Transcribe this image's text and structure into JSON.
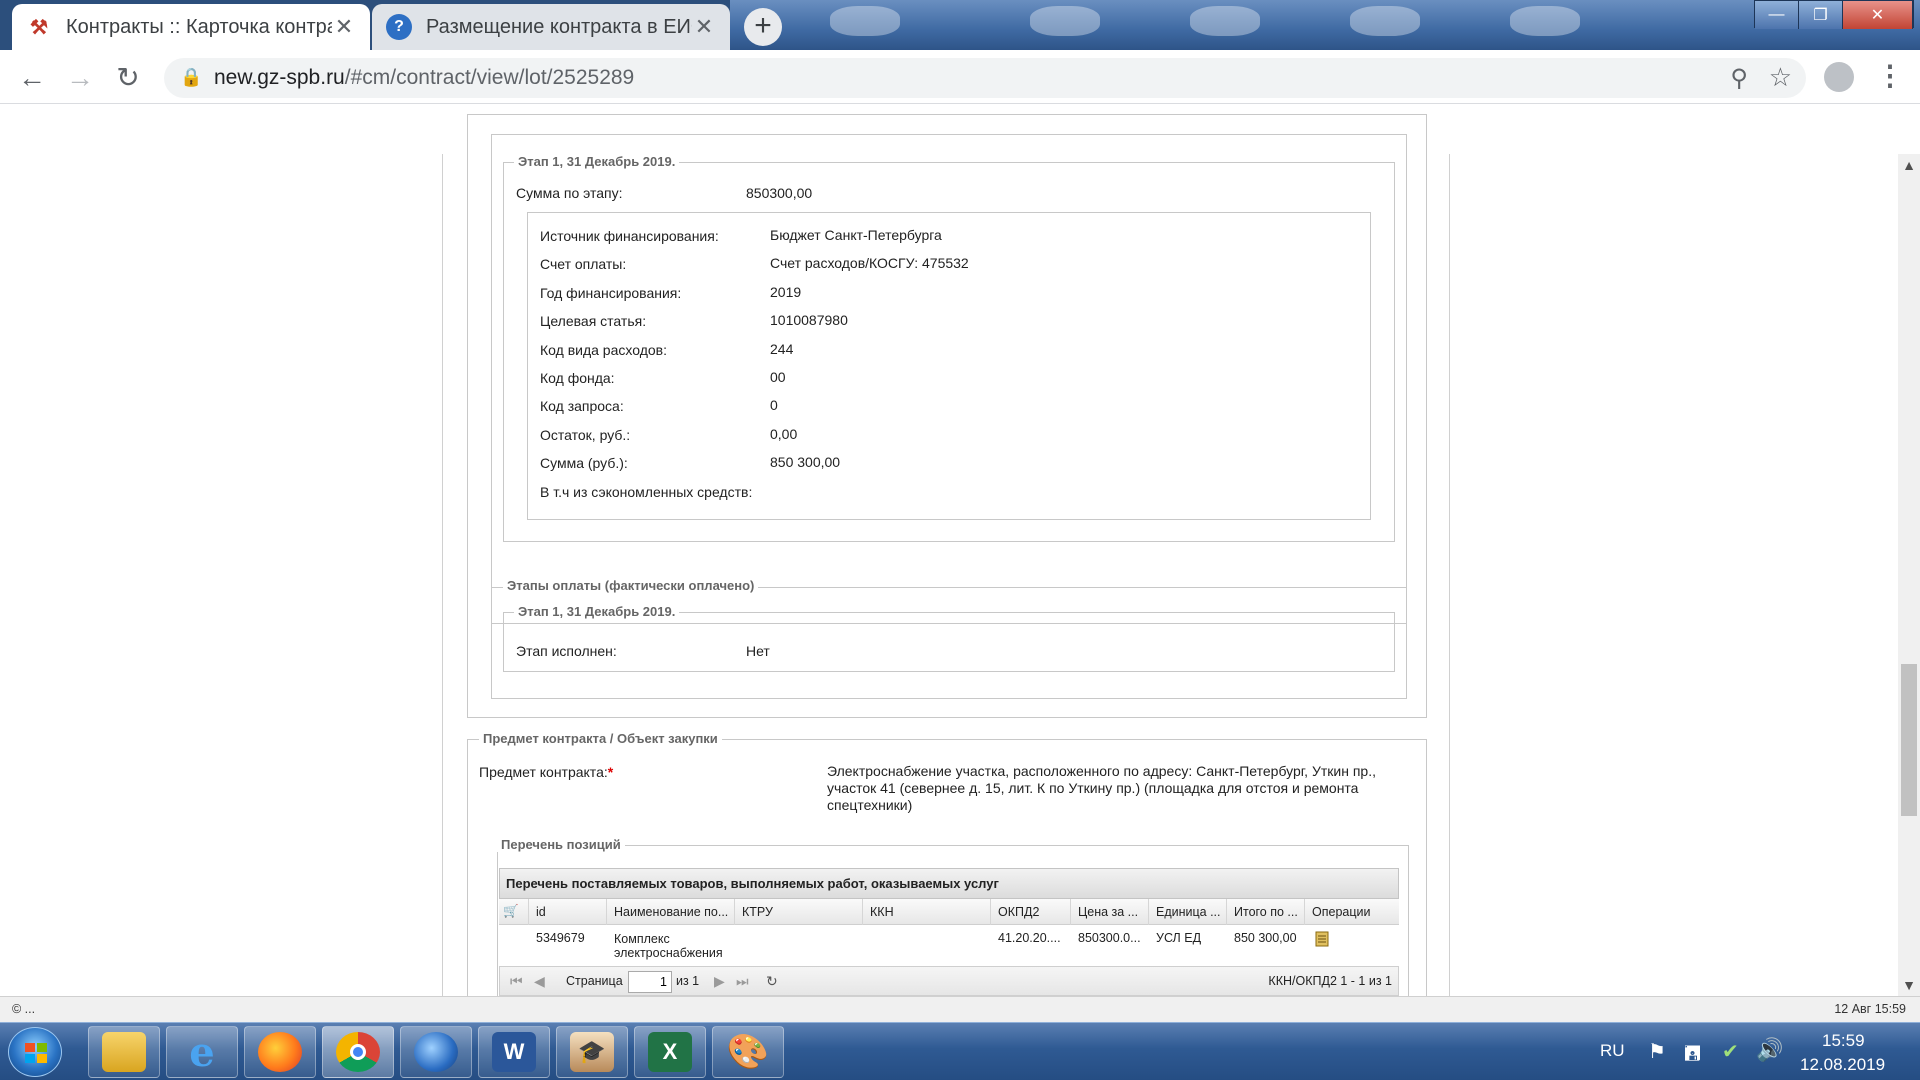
{
  "browser": {
    "tabs": [
      {
        "title": "Контракты :: Карточка контракт",
        "active": true
      },
      {
        "title": "Размещение контракта в ЕИС |",
        "active": false
      }
    ],
    "url_host": "new.gz-spb.ru",
    "url_path": "/#cm/contract/view/lot/2525289"
  },
  "stage_plan": {
    "legend": "Этап 1, 31 Декабрь 2019.",
    "sum_label": "Сумма по этапу:",
    "sum_value": "850300,00",
    "financing": [
      {
        "label": "Источник финансирования:",
        "value": "Бюджет Санкт-Петербурга"
      },
      {
        "label": "Счет оплаты:",
        "value": "Счет расходов/КОСГУ: 475532"
      },
      {
        "label": "Год финансирования:",
        "value": "2019"
      },
      {
        "label": "Целевая статья:",
        "value": "1010087980"
      },
      {
        "label": "Код вида расходов:",
        "value": "244"
      },
      {
        "label": "Код фонда:",
        "value": "00"
      },
      {
        "label": "Код запроса:",
        "value": "0"
      },
      {
        "label": "Остаток, руб.:",
        "value": "0,00"
      },
      {
        "label": "Сумма (руб.):",
        "value": "850 300,00"
      },
      {
        "label": "В т.ч из сэкономленных средств:",
        "value": ""
      }
    ]
  },
  "stage_paid": {
    "legend": "Этапы оплаты (фактически оплачено)",
    "inner_legend": "Этап 1, 31 Декабрь 2019.",
    "done_label": "Этап исполнен:",
    "done_value": "Нет"
  },
  "subject": {
    "legend": "Предмет контракта / Объект закупки",
    "label": "Предмет контракта:",
    "required_mark": "*",
    "text_lines": [
      "Электроснабжение  участка, расположенного по адресу: Санкт-Петербург, Уткин пр.,",
      "участок 41 (севернее д. 15, лит. К по Уткину пр.) (площадка для отстоя и ремонта",
      "спецтехники)"
    ]
  },
  "positions": {
    "legend": "Перечень позиций",
    "grid_title": "Перечень поставляемых товаров, выполняемых работ, оказываемых услуг",
    "columns": [
      "id",
      "Наименование по...",
      "КТРУ",
      "ККН",
      "ОКПД2",
      "Цена за ...",
      "Единица ...",
      "Итого по ...",
      "Операции"
    ],
    "row": {
      "id": "5349679",
      "name_line1": "Комплекс",
      "name_line2": "электроснабжения",
      "ktru": "",
      "kkn": "",
      "okpd2": "41.20.20....",
      "price": "850300.0...",
      "unit": "УСЛ ЕД",
      "total": "850 300,00"
    },
    "pager": {
      "page_label": "Страница",
      "page_value": "1",
      "of_label": "из 1",
      "summary": "ККН/ОКПД2 1 - 1 из 1"
    }
  },
  "statusbar": {
    "left": "© ...",
    "right": "12 Авг 15:59"
  },
  "taskbar": {
    "lang": "RU",
    "time": "15:59",
    "date": "12.08.2019"
  }
}
